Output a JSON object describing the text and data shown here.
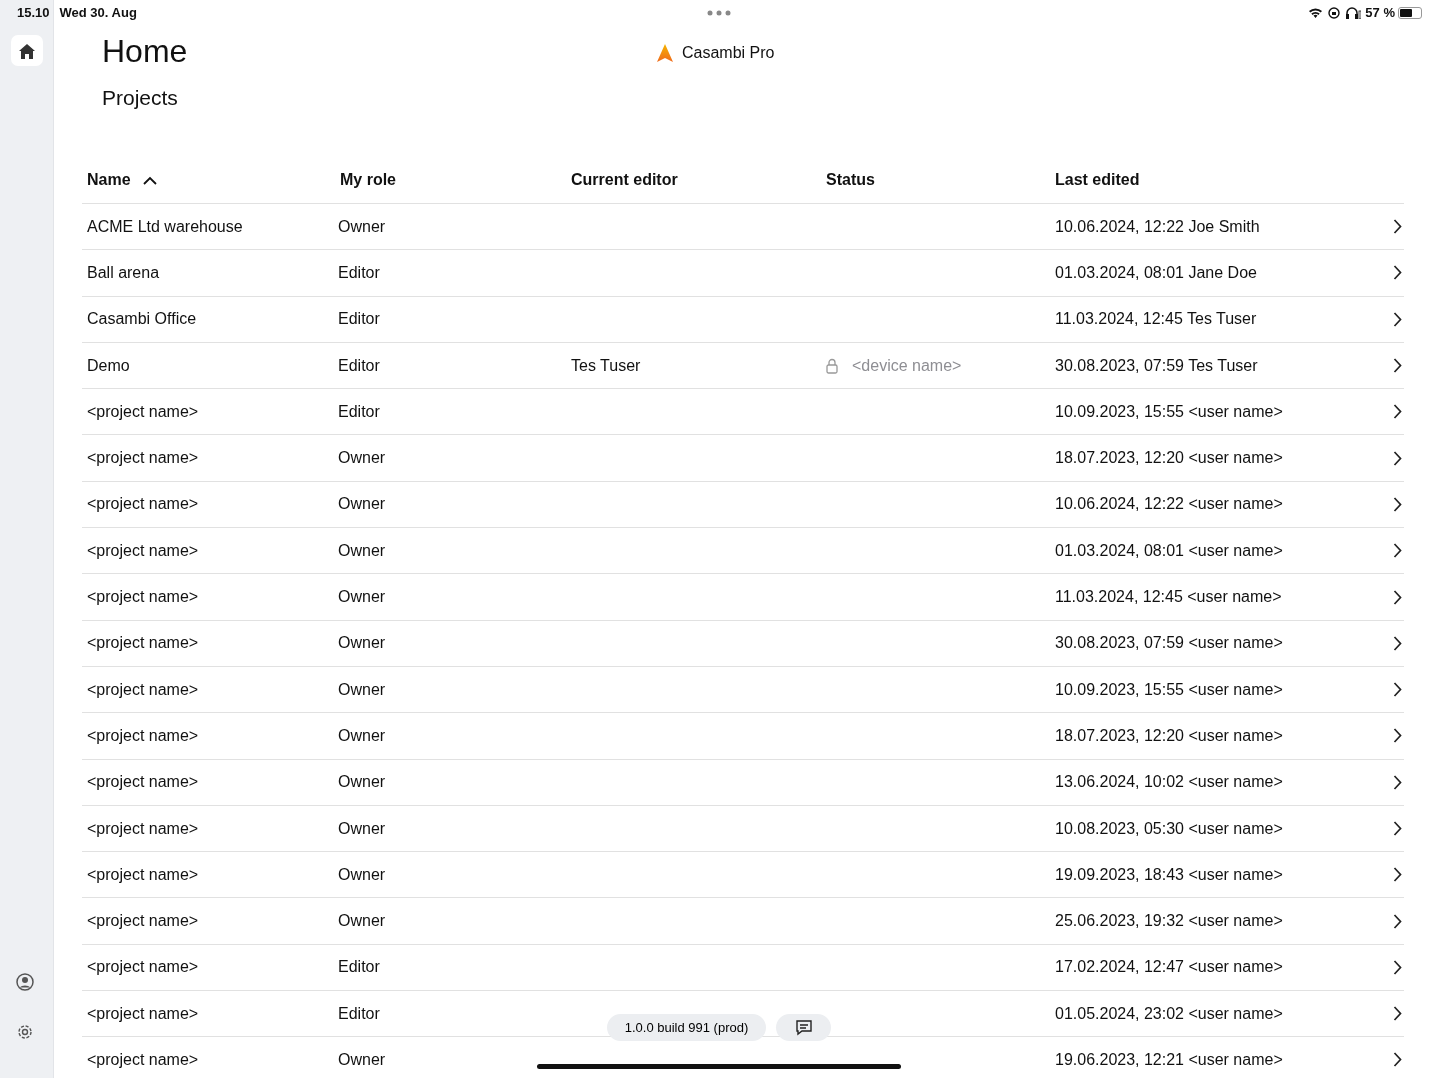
{
  "status_bar": {
    "time": "15.10",
    "date": "Wed 30. Aug",
    "battery": "57 %"
  },
  "page": {
    "title": "Home",
    "subtitle": "Projects",
    "app_name": "Casambi Pro"
  },
  "table": {
    "columns": [
      {
        "label": "Name",
        "sorted": true
      },
      {
        "label": "My role",
        "sorted": false
      },
      {
        "label": "Current editor",
        "sorted": false
      },
      {
        "label": "Status",
        "sorted": false
      },
      {
        "label": "Last edited",
        "sorted": false
      }
    ],
    "rows": [
      {
        "name": "ACME Ltd warehouse",
        "role": "Owner",
        "last_edited": "10.06.2024, 12:22 Joe Smith"
      },
      {
        "name": "Ball arena",
        "role": "Editor",
        "last_edited": "01.03.2024, 08:01 Jane Doe"
      },
      {
        "name": "Casambi Office",
        "role": "Editor",
        "last_edited": "11.03.2024, 12:45 Tes Tuser"
      },
      {
        "name": "Demo",
        "role": "Editor",
        "editor": "Tes Tuser",
        "status": {
          "device": "<device name>",
          "locked": true
        },
        "last_edited": "30.08.2023, 07:59 Tes Tuser"
      },
      {
        "name": "<project name>",
        "role": "Editor",
        "last_edited": "10.09.2023, 15:55 <user name>"
      },
      {
        "name": "<project name>",
        "role": "Owner",
        "last_edited": "18.07.2023, 12:20 <user name>"
      },
      {
        "name": "<project name>",
        "role": "Owner",
        "last_edited": "10.06.2024, 12:22 <user name>"
      },
      {
        "name": "<project name>",
        "role": "Owner",
        "last_edited": "01.03.2024, 08:01 <user name>"
      },
      {
        "name": "<project name>",
        "role": "Owner",
        "last_edited": "11.03.2024, 12:45 <user name>"
      },
      {
        "name": "<project name>",
        "role": "Owner",
        "last_edited": "30.08.2023, 07:59 <user name>"
      },
      {
        "name": "<project name>",
        "role": "Owner",
        "last_edited": "10.09.2023, 15:55 <user name>"
      },
      {
        "name": "<project name>",
        "role": "Owner",
        "last_edited": "18.07.2023, 12:20 <user name>"
      },
      {
        "name": "<project name>",
        "role": "Owner",
        "last_edited": "13.06.2024, 10:02 <user name>"
      },
      {
        "name": "<project name>",
        "role": "Owner",
        "last_edited": "10.08.2023, 05:30 <user name>"
      },
      {
        "name": "<project name>",
        "role": "Owner",
        "last_edited": "19.09.2023, 18:43 <user name>"
      },
      {
        "name": "<project name>",
        "role": "Owner",
        "last_edited": "25.06.2023, 19:32 <user name>"
      },
      {
        "name": "<project name>",
        "role": "Editor",
        "last_edited": "17.02.2024, 12:47 <user name>"
      },
      {
        "name": "<project name>",
        "role": "Editor",
        "last_edited": "01.05.2024, 23:02 <user name>"
      },
      {
        "name": "<project name>",
        "role": "Owner",
        "last_edited": "19.06.2023, 12:21 <user name>"
      }
    ]
  },
  "footer": {
    "version": "1.0.0 build 991 (prod)"
  }
}
